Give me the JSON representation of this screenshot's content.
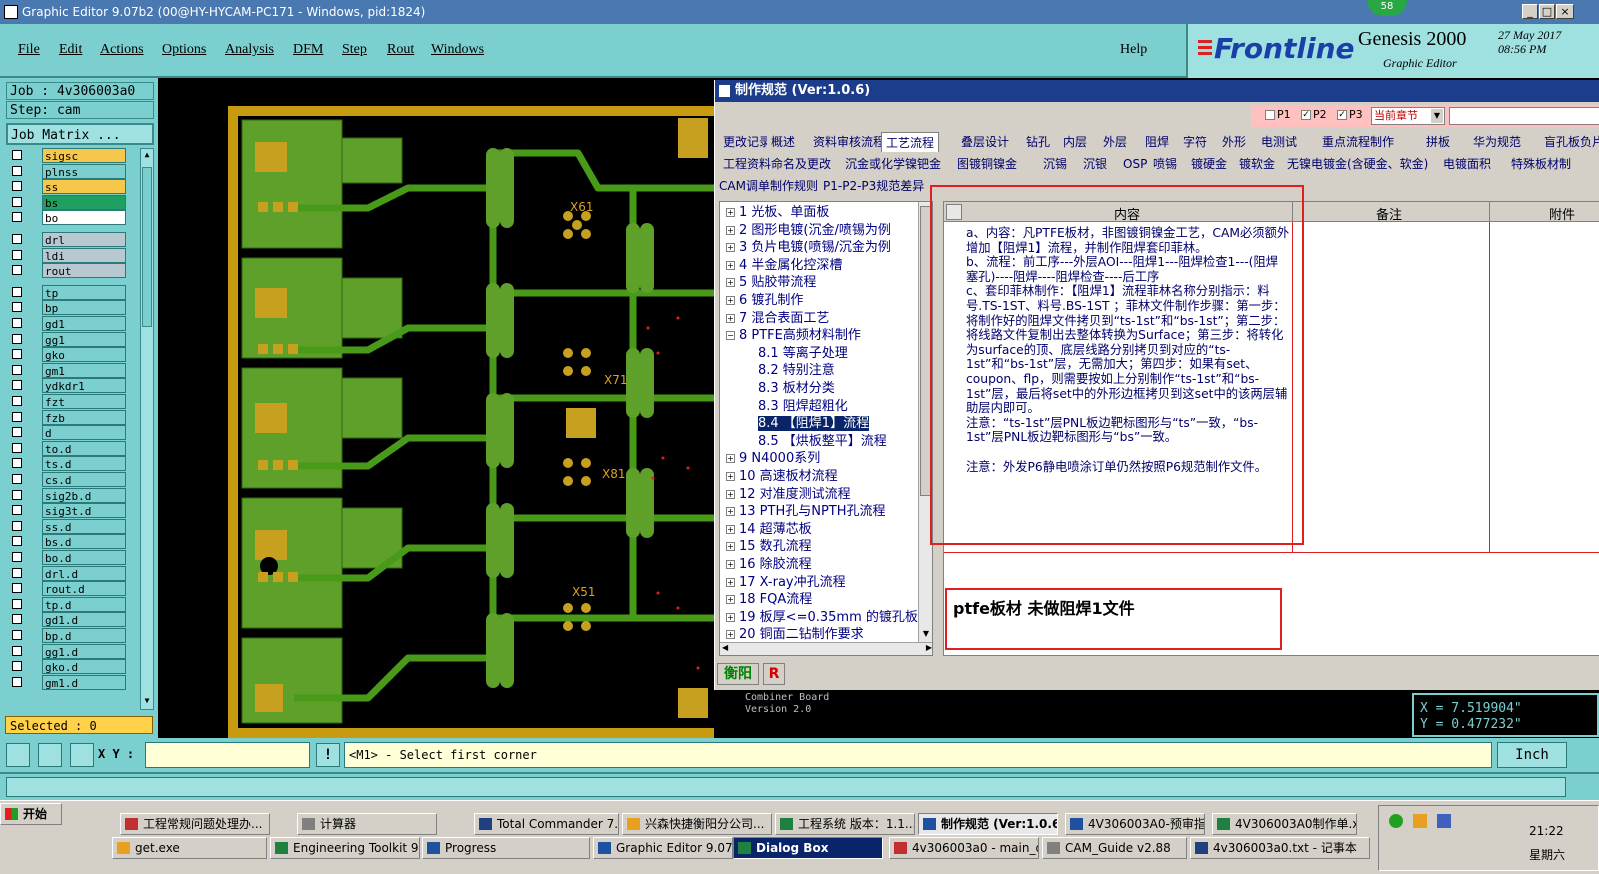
{
  "window": {
    "title": "Graphic Editor 9.07b2 (00@HY-HYCAM-PC171 - Windows, pid:1824)",
    "badge": "58"
  },
  "menu": [
    "File",
    "Edit",
    "Actions",
    "Options",
    "Analysis",
    "DFM",
    "Step",
    "Rout",
    "Windows"
  ],
  "help": "Help",
  "brand": {
    "logo": "Frontline",
    "product": "Genesis 2000",
    "sub": "Graphic Editor",
    "date": "27 May 2017",
    "time": "08:56 PM"
  },
  "job": {
    "job": "Job : 4v306003a0",
    "step": "Step: cam",
    "matrix": "Job Matrix ..."
  },
  "layers": [
    {
      "name": "sigsc",
      "bg": "#f5c74a"
    },
    {
      "name": "plnss",
      "bg": "#7ccfcf"
    },
    {
      "name": "ss",
      "bg": "#f5c74a"
    },
    {
      "name": "bs",
      "bg": "#20a060"
    },
    {
      "name": "bo",
      "bg": "#ffffff"
    },
    {
      "name": "drl",
      "bg": "#b8c8d0"
    },
    {
      "name": "ldi",
      "bg": "#b8c8d0"
    },
    {
      "name": "rout",
      "bg": "#b8c8d0"
    },
    {
      "name": "tp"
    },
    {
      "name": "bp"
    },
    {
      "name": "gd1"
    },
    {
      "name": "gg1"
    },
    {
      "name": "gko"
    },
    {
      "name": "gm1"
    },
    {
      "name": "ydkdr1"
    },
    {
      "name": "fzt"
    },
    {
      "name": "fzb"
    },
    {
      "name": "d"
    },
    {
      "name": "to.d"
    },
    {
      "name": "ts.d"
    },
    {
      "name": "cs.d"
    },
    {
      "name": "sig2b.d"
    },
    {
      "name": "sig3t.d"
    },
    {
      "name": "ss.d"
    },
    {
      "name": "bs.d"
    },
    {
      "name": "bo.d"
    },
    {
      "name": "drl.d"
    },
    {
      "name": "rout.d"
    },
    {
      "name": "tp.d"
    },
    {
      "name": "gd1.d"
    },
    {
      "name": "bp.d"
    },
    {
      "name": "gg1.d"
    },
    {
      "name": "gko.d"
    },
    {
      "name": "gm1.d"
    }
  ],
  "canvas": {
    "labels": [
      "X61",
      "X71",
      "X81",
      "X51"
    ],
    "board_text": [
      "Combiner Board",
      "Version 2.0"
    ]
  },
  "dialog": {
    "title": "制作规范 (Ver:1.0.6)",
    "checks": [
      "P1",
      "P2",
      "P3"
    ],
    "chapter_select": "当前章节",
    "tabs_row1": [
      "更改记录",
      "概述",
      "资料审核流程",
      "工艺流程",
      "叠层设计",
      "钻孔",
      "内层",
      "外层",
      "阻焊",
      "字符",
      "外形",
      "电测试",
      "重点流程制作",
      "拼板",
      "华为规范",
      "盲孔板负片"
    ],
    "tabs_row2": [
      "工程资料命名及更改",
      "沉金或化学镍钯金",
      "图镀铜镍金",
      "沉锡",
      "沉银",
      "OSP",
      "喷锡",
      "镀硬金",
      "镀软金",
      "无镍电镀金(含硬金、软金)",
      "电镀面积",
      "特殊板材制"
    ],
    "tabs_row3": [
      "CAM调单制作规则",
      "P1-P2-P3规范差异"
    ],
    "tree": [
      "1 光板、单面板",
      "2 图形电镀(沉金/喷锡为例",
      "3 负片电镀(喷锡/沉金为例",
      "4 半金属化控深槽",
      "5 贴胶带流程",
      "6 镀孔制作",
      "7 混合表面工艺",
      "8 PTFE高频材料制作",
      "8.1 等离子处理",
      "8.2 特别注意",
      "8.3 板材分类",
      "8.3 阻焊超粗化",
      "8.4 【阻焊1】流程",
      "8.5 【烘板整平】流程",
      "9 N4000系列",
      "10 高速板材流程",
      "12 对准度测试流程",
      "13 PTH孔与NPTH孔流程",
      "14 超薄芯板",
      "15 数孔流程",
      "16 除胶流程",
      "17 X-ray冲孔流程",
      "18 FQA流程",
      "19 板厚<=0.35mm 的镀孔板",
      "20 铜面二钻制作要求"
    ],
    "grid_headers": [
      "内容",
      "备注",
      "附件"
    ],
    "content": "a、内容：凡PTFE板材，非图镀铜镍金工艺，CAM必须额外增加【阻焊1】流程，并制作阻焊套印菲林。\nb、流程：前工序---外层AOI---阻焊1---阻焊检查1---(阻焊塞孔)----阻焊----阻焊检查----后工序\nc、套印菲林制作：【阻焊1】流程菲林名称分别指示：料号.TS-1ST、料号.BS-1ST ；菲林文件制作步骤：第一步：将制作好的阻焊文件拷贝到“ts-1st”和“bs-1st”；第二步：将线路文件复制出去整体转换为Surface；第三步：将转化为surface的顶、底层线路分别拷贝到对应的“ts-1st”和“bs-1st”层，无需加大；第四步：如果有set、coupon、flp，则需要按如上分别制作“ts-1st”和“bs-1st”层，最后将set中的外形边框拷贝到这set中的该两层辅助层内即可。\n注意：“ts-1st”层PNL板边靶标图形与“ts”一致，“bs-1st”层PNL板边靶标图形与“bs”一致。\n\n注意：外发P6静电喷涂订单仍然按照P6规范制作文件。",
    "note": "ptfe板材  未做阻焊1文件",
    "bottom_tabs": [
      "衡阳",
      "R"
    ]
  },
  "status": {
    "selected": "Selected : 0",
    "xy_label": "X Y :",
    "prompt": "<M1> - Select first corner",
    "unit": "Inch",
    "coord_x": "X = 7.519904\"",
    "coord_y": "Y = 0.477232\""
  },
  "taskbar": {
    "start": "开始",
    "row1": [
      "工程常规问题处理办...",
      "计算器",
      "Total Commander 7.0 ...",
      "兴森快捷衡阳分公司...",
      "工程系统  版本：1.1...",
      "制作规范 (Ver:1.0.6)",
      "4V306003A0-预审指...",
      "4V306003A0制作单.x..."
    ],
    "row2": [
      "get.exe",
      "Engineering Toolkit 9.07...",
      "Progress",
      "Graphic Editor 9.07b2 (0...",
      "Dialog Box",
      "4v306003a0 - main_qa",
      "CAM_Guide v2.88",
      "4v306003a0.txt - 记事本"
    ],
    "clock": "21:22",
    "day": "星期六"
  }
}
